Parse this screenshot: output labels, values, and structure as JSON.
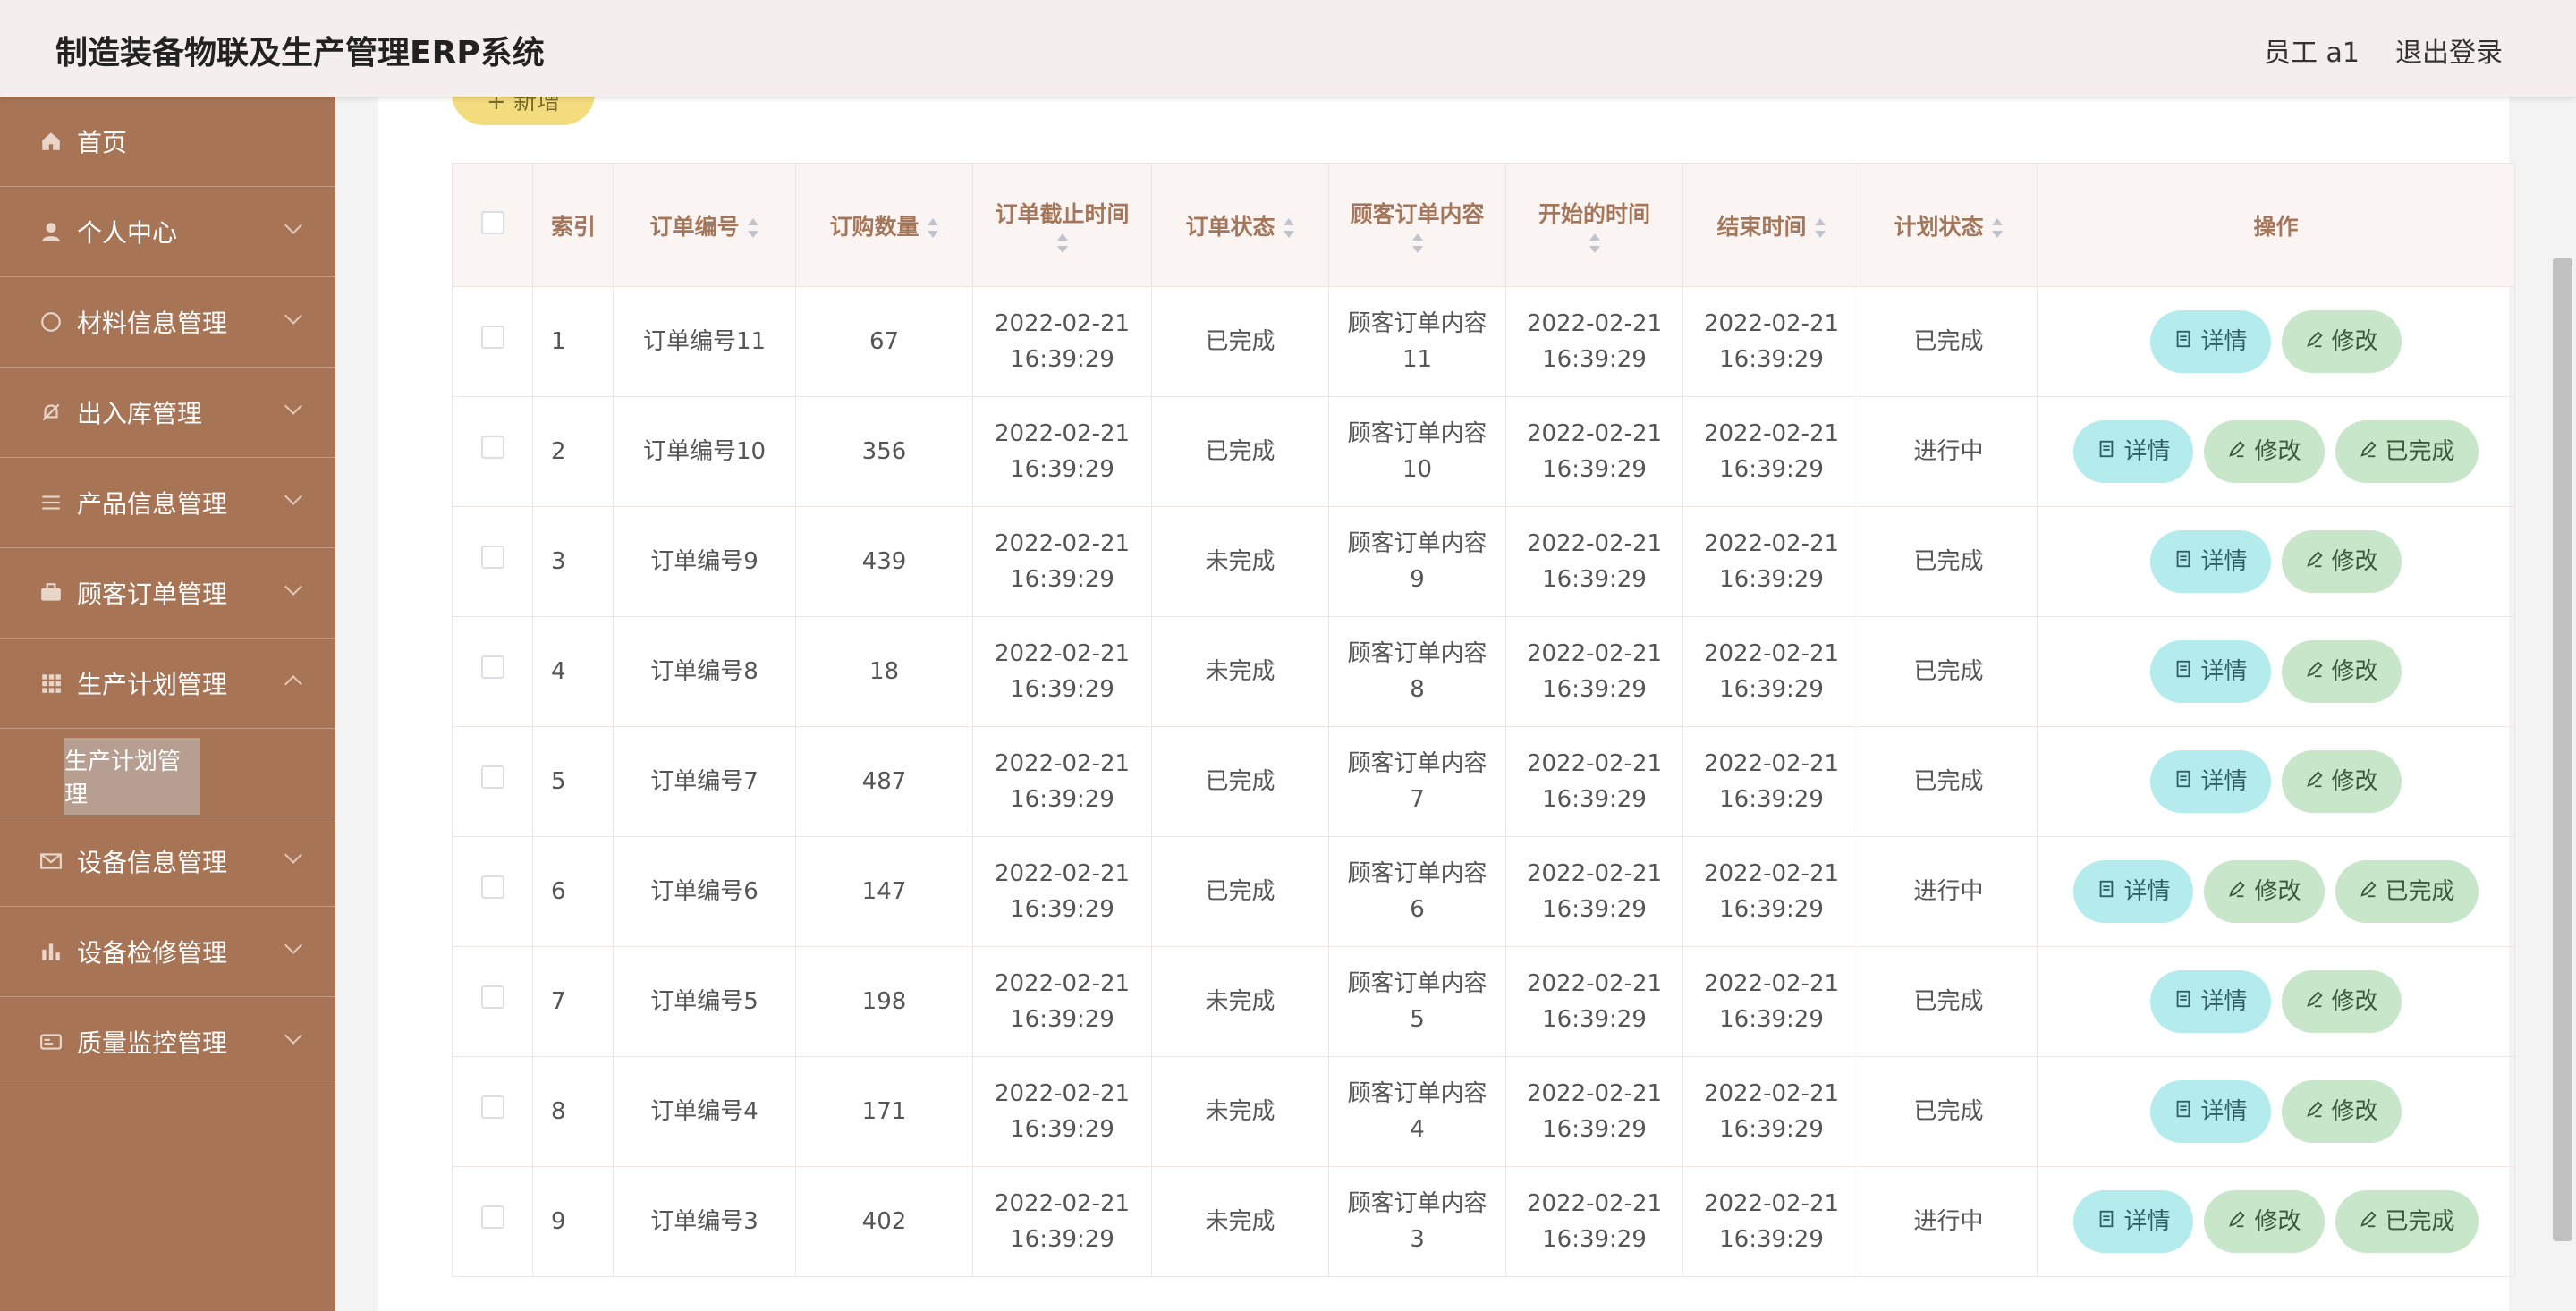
{
  "header": {
    "title": "制造装备物联及生产管理ERP系统",
    "user": "员工 a1",
    "logout": "退出登录"
  },
  "sidebar": {
    "items": [
      {
        "label": "首页",
        "icon": "home-icon"
      },
      {
        "label": "个人中心",
        "icon": "user-icon"
      },
      {
        "label": "材料信息管理",
        "icon": "compass-icon"
      },
      {
        "label": "出入库管理",
        "icon": "bell-off-icon"
      },
      {
        "label": "产品信息管理",
        "icon": "list-icon"
      },
      {
        "label": "顾客订单管理",
        "icon": "briefcase-icon"
      },
      {
        "label": "生产计划管理",
        "icon": "grid-icon"
      },
      {
        "label": "设备信息管理",
        "icon": "mail-icon"
      },
      {
        "label": "设备检修管理",
        "icon": "bar-chart-icon"
      },
      {
        "label": "质量监控管理",
        "icon": "card-icon"
      }
    ],
    "sub_item": "生产计划管理"
  },
  "toolbar": {
    "add_label": "+ 新增"
  },
  "table": {
    "columns": [
      "索引",
      "订单编号",
      "订购数量",
      "订单截止时间",
      "订单状态",
      "顾客订单内容",
      "开始的时间",
      "结束时间",
      "计划状态",
      "操作"
    ],
    "buttons": {
      "detail": "详情",
      "edit": "修改",
      "done": "已完成"
    },
    "rows": [
      {
        "index": "1",
        "order_no": "订单编号11",
        "qty": "67",
        "deadline_date": "2022-02-21",
        "deadline_time": "16:39:29",
        "order_status": "已完成",
        "content_a": "顾客订单内容",
        "content_b": "11",
        "start_date": "2022-02-21",
        "start_time": "16:39:29",
        "end_date": "2022-02-21",
        "end_time": "16:39:29",
        "plan_status": "已完成",
        "show_done": false
      },
      {
        "index": "2",
        "order_no": "订单编号10",
        "qty": "356",
        "deadline_date": "2022-02-21",
        "deadline_time": "16:39:29",
        "order_status": "已完成",
        "content_a": "顾客订单内容",
        "content_b": "10",
        "start_date": "2022-02-21",
        "start_time": "16:39:29",
        "end_date": "2022-02-21",
        "end_time": "16:39:29",
        "plan_status": "进行中",
        "show_done": true
      },
      {
        "index": "3",
        "order_no": "订单编号9",
        "qty": "439",
        "deadline_date": "2022-02-21",
        "deadline_time": "16:39:29",
        "order_status": "未完成",
        "content_a": "顾客订单内容",
        "content_b": "9",
        "start_date": "2022-02-21",
        "start_time": "16:39:29",
        "end_date": "2022-02-21",
        "end_time": "16:39:29",
        "plan_status": "已完成",
        "show_done": false
      },
      {
        "index": "4",
        "order_no": "订单编号8",
        "qty": "18",
        "deadline_date": "2022-02-21",
        "deadline_time": "16:39:29",
        "order_status": "未完成",
        "content_a": "顾客订单内容",
        "content_b": "8",
        "start_date": "2022-02-21",
        "start_time": "16:39:29",
        "end_date": "2022-02-21",
        "end_time": "16:39:29",
        "plan_status": "已完成",
        "show_done": false
      },
      {
        "index": "5",
        "order_no": "订单编号7",
        "qty": "487",
        "deadline_date": "2022-02-21",
        "deadline_time": "16:39:29",
        "order_status": "已完成",
        "content_a": "顾客订单内容",
        "content_b": "7",
        "start_date": "2022-02-21",
        "start_time": "16:39:29",
        "end_date": "2022-02-21",
        "end_time": "16:39:29",
        "plan_status": "已完成",
        "show_done": false
      },
      {
        "index": "6",
        "order_no": "订单编号6",
        "qty": "147",
        "deadline_date": "2022-02-21",
        "deadline_time": "16:39:29",
        "order_status": "已完成",
        "content_a": "顾客订单内容",
        "content_b": "6",
        "start_date": "2022-02-21",
        "start_time": "16:39:29",
        "end_date": "2022-02-21",
        "end_time": "16:39:29",
        "plan_status": "进行中",
        "show_done": true
      },
      {
        "index": "7",
        "order_no": "订单编号5",
        "qty": "198",
        "deadline_date": "2022-02-21",
        "deadline_time": "16:39:29",
        "order_status": "未完成",
        "content_a": "顾客订单内容",
        "content_b": "5",
        "start_date": "2022-02-21",
        "start_time": "16:39:29",
        "end_date": "2022-02-21",
        "end_time": "16:39:29",
        "plan_status": "已完成",
        "show_done": false
      },
      {
        "index": "8",
        "order_no": "订单编号4",
        "qty": "171",
        "deadline_date": "2022-02-21",
        "deadline_time": "16:39:29",
        "order_status": "未完成",
        "content_a": "顾客订单内容",
        "content_b": "4",
        "start_date": "2022-02-21",
        "start_time": "16:39:29",
        "end_date": "2022-02-21",
        "end_time": "16:39:29",
        "plan_status": "已完成",
        "show_done": false
      },
      {
        "index": "9",
        "order_no": "订单编号3",
        "qty": "402",
        "deadline_date": "2022-02-21",
        "deadline_time": "16:39:29",
        "order_status": "未完成",
        "content_a": "顾客订单内容",
        "content_b": "3",
        "start_date": "2022-02-21",
        "start_time": "16:39:29",
        "end_date": "2022-02-21",
        "end_time": "16:39:29",
        "plan_status": "进行中",
        "show_done": true
      }
    ]
  }
}
